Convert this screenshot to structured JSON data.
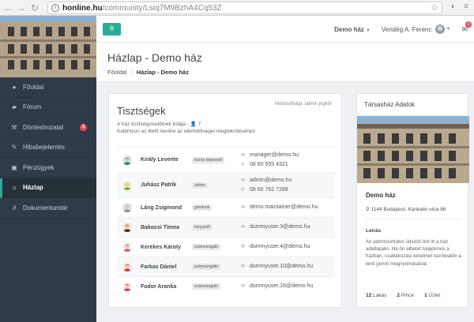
{
  "browser": {
    "url_host": "honline.hu",
    "url_path": "/community/Lsiq7M9BzhA4Cq53Z"
  },
  "topbar": {
    "house_label": "Demo ház",
    "user_label": "Vendég A. Ferenc",
    "mail_count": "2"
  },
  "sidebar": {
    "items": [
      {
        "label": "Főoldal",
        "icon": "info-icon"
      },
      {
        "label": "Fórum",
        "icon": "comments-icon"
      },
      {
        "label": "Döntéshozatal",
        "icon": "gavel-icon",
        "badge": "3"
      },
      {
        "label": "Hibabejelentés",
        "icon": "wrench-icon"
      },
      {
        "label": "Pénzügyek",
        "icon": "money-icon"
      },
      {
        "label": "Házlap",
        "icon": "home-icon"
      },
      {
        "label": "Dokumentumtár",
        "icon": "paperclip-icon"
      }
    ]
  },
  "page": {
    "title": "Házlap - Demo ház",
    "breadcrumb_home": "Főoldal",
    "breadcrumb_current": "Házlap - Demo ház"
  },
  "officials": {
    "title": "Tisztségek",
    "note": "Módosíthatja: admin jogkör",
    "desc_line1": "A ház tisztségviselőinek listája - 👤 7",
    "desc_line2": "Kattintson az illető nevére az elérhetőségei megtekintéséhez.",
    "members": [
      {
        "name": "Király Levente",
        "role": "közös képviselő",
        "email": "manager@demo.hu",
        "phone": "06 60 555 4321",
        "avatar_bg": "#cfe8f3",
        "shirt": "#2c8a5a",
        "hair": "#3b2a1a"
      },
      {
        "name": "Juhász Patrik",
        "role": "admin",
        "email": "admin@demo.hu",
        "phone": "06 60 762 7288",
        "avatar_bg": "#e9f3c9",
        "shirt": "#7db22a",
        "hair": "#e0b236"
      },
      {
        "name": "Láng Zsigmond",
        "role": "gondnok",
        "email": "demo.maintainer@demo.hu",
        "avatar_bg": "#dfe2e5",
        "shirt": "#8d949b",
        "hair": "#8d949b"
      },
      {
        "name": "Bakocsi Tímea",
        "role": "könyvelő",
        "email": "dummyuser.3@demo.hu",
        "avatar_bg": "#f3e3e3",
        "shirt": "#333333",
        "hair": "#2b1d14"
      },
      {
        "name": "Kerekes Károly",
        "role": "számvizsgáló",
        "email": "dummyuser.4@demo.hu",
        "avatar_bg": "#e6f1f7",
        "shirt": "#e2585b",
        "hair": "#5a3a22"
      },
      {
        "name": "Farkas Dániel",
        "role": "számvizsgáló",
        "email": "dummyuser.10@demo.hu",
        "avatar_bg": "#fbe6e6",
        "shirt": "#d9383e",
        "hair": "#2a2a2a"
      },
      {
        "name": "Fodor Aranka",
        "role": "számvizsgáló",
        "email": "dummyuser.16@demo.hu",
        "avatar_bg": "#fbeef0",
        "shirt": "#d13c7a",
        "hair": "#2b1d14"
      }
    ]
  },
  "panel": {
    "title": "Társasház Adatok",
    "name": "Demo ház",
    "address": "1144 Budapest, Kankalin utca 86",
    "desc_label": "Leírás",
    "description": "Az adminisztrátor üdvözli önt itt a ház adatlapján. Ha ön albetét tulajdonos a házban, csatlakozási kérelmet tud beadni a lenti gomb megnyomásával.",
    "stats": [
      {
        "count": "12",
        "label": "Lakás"
      },
      {
        "count": "2",
        "label": "Pince"
      },
      {
        "count": "1",
        "label": "Üzlet"
      }
    ]
  }
}
